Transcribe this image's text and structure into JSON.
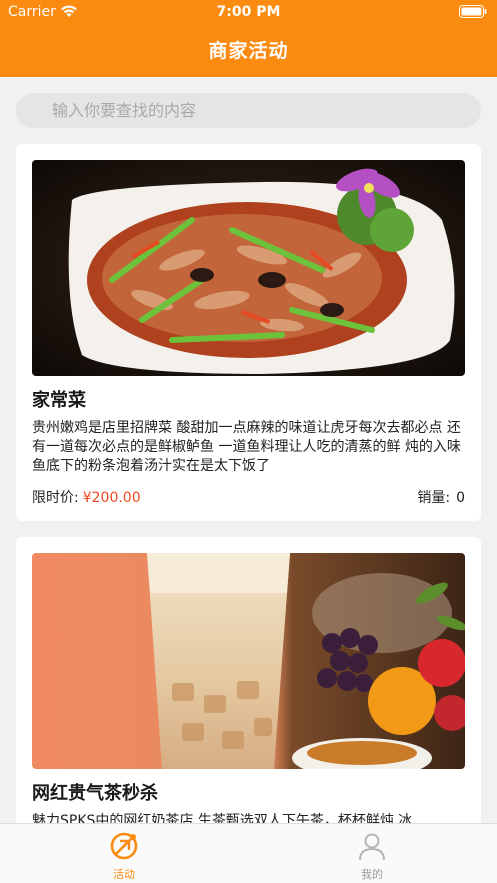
{
  "status_bar": {
    "carrier": "Carrier",
    "time": "7:00 PM"
  },
  "nav": {
    "title": "商家活动"
  },
  "search": {
    "placeholder": "输入你要查找的内容",
    "value": ""
  },
  "products": [
    {
      "title": "家常菜",
      "description": "贵州嫩鸡是店里招牌菜 酸甜加一点麻辣的味道让虎牙每次去都必点 还有一道每次必点的是鲜椒鲈鱼 一道鱼料理让人吃的清蒸的鲜 炖的入味 鱼底下的粉条泡着汤汁实在是太下饭了",
      "price_label": "限时价:",
      "price": "¥200.00",
      "sales_label": "销量:",
      "sales": "0",
      "image_icon": "stir-fry-dish-photo"
    },
    {
      "title": "网红贵气茶秒杀",
      "description": "魅力SPKS中的网红奶茶店,生茶甄选双人下午茶，杯杯鲜炖,冰",
      "image_icon": "milk-tea-photo"
    }
  ],
  "tabs": [
    {
      "label": "活动",
      "icon": "activity-icon",
      "active": true
    },
    {
      "label": "我的",
      "icon": "user-icon",
      "active": false
    }
  ],
  "colors": {
    "accent": "#fb8a10",
    "price": "#f04a22",
    "background": "#f1f1f1"
  }
}
